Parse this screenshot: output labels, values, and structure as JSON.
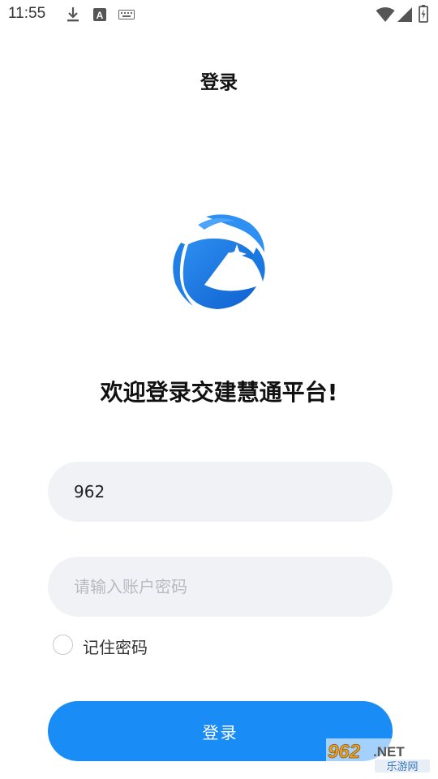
{
  "status_bar": {
    "time": "11:55",
    "left_icons": [
      "download-icon",
      "font-a-icon",
      "keyboard-icon"
    ],
    "right_icons": [
      "wifi-icon",
      "signal-icon",
      "battery-icon"
    ]
  },
  "header": {
    "title": "登录"
  },
  "welcome_text": "欢迎登录交建慧通平台!",
  "form": {
    "account_value": "962",
    "password_placeholder": "请输入账户密码",
    "remember_label": "记住密码",
    "remember_checked": false,
    "login_button_label": "登录"
  },
  "watermark": {
    "top": "962.NET",
    "bottom": "乐游网"
  },
  "colors": {
    "accent": "#1a8cf5",
    "input_bg": "#f1f2f6",
    "placeholder": "#b7bac1"
  }
}
